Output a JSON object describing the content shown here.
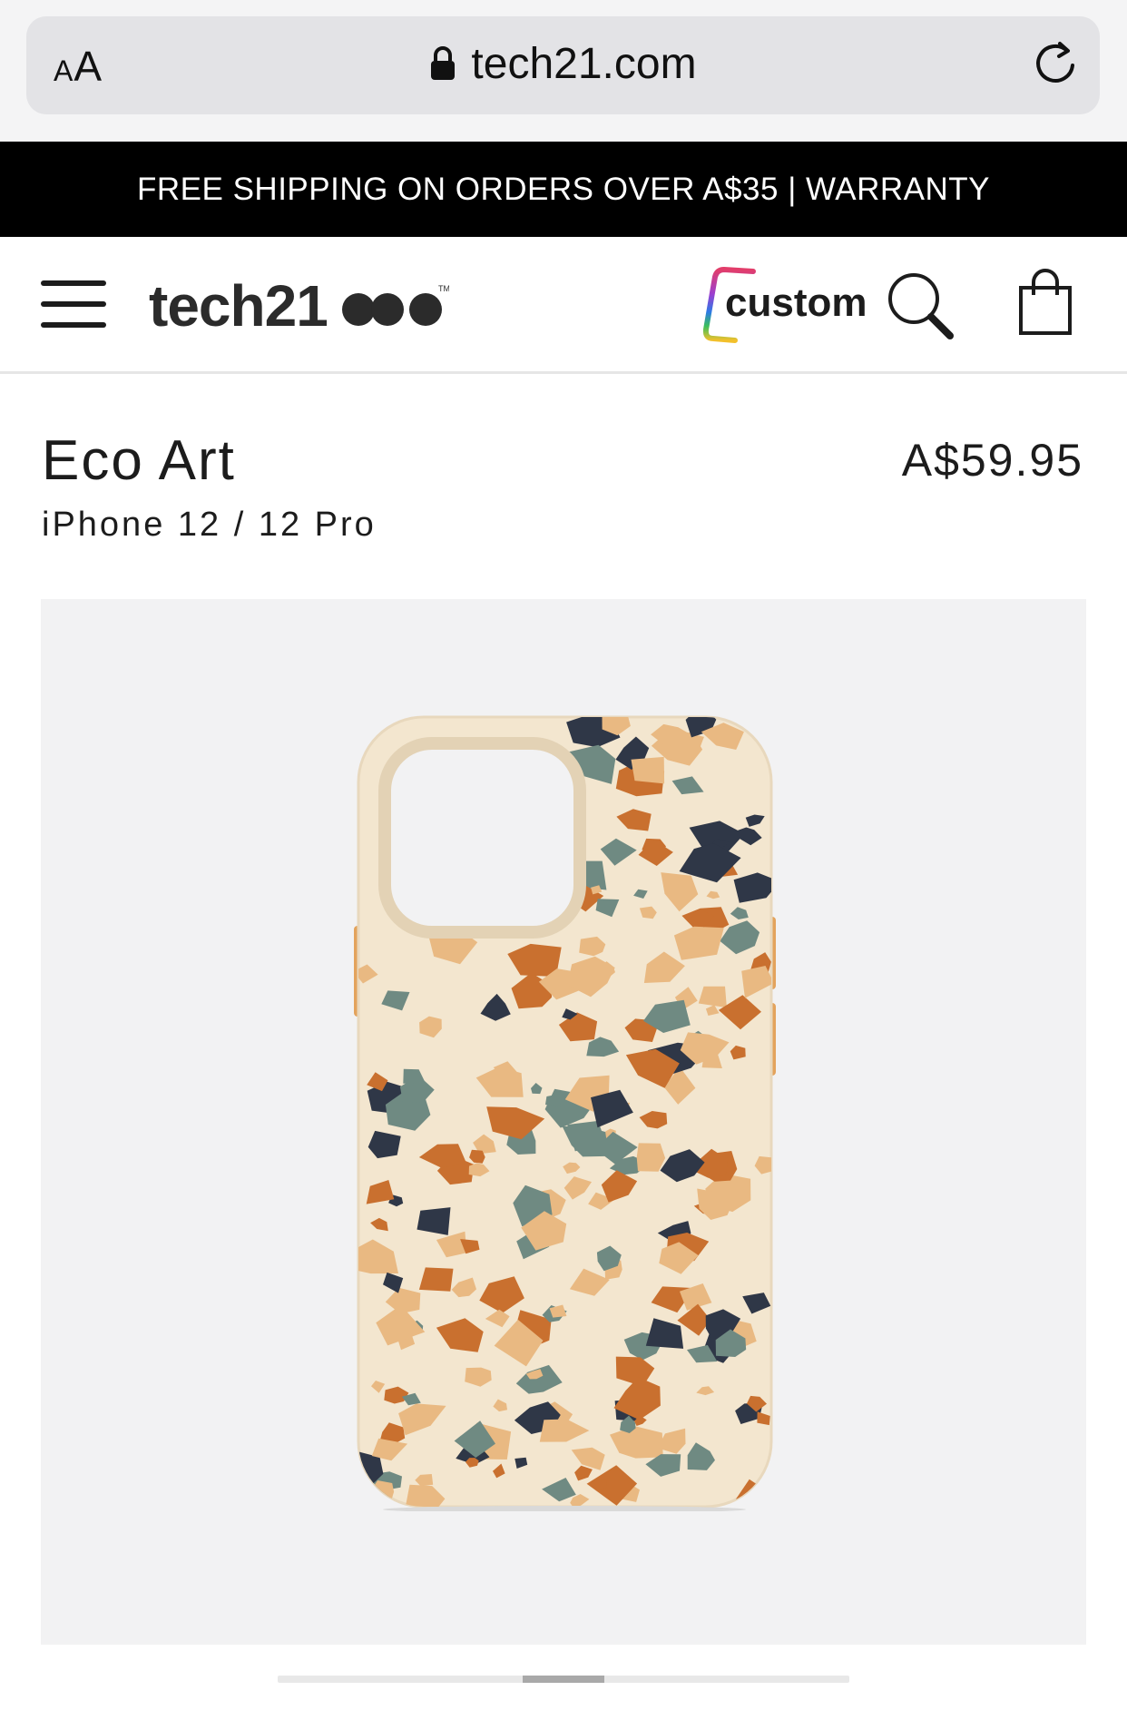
{
  "browser": {
    "text_size_label_small": "A",
    "text_size_label_large": "A",
    "url": "tech21.com",
    "icons": {
      "lock": "lock-icon",
      "reload": "reload-icon"
    }
  },
  "promo": {
    "text": "FREE SHIPPING ON ORDERS OVER A$35 | WARRANTY"
  },
  "header": {
    "logo_text": "tech21",
    "custom_label": "custom",
    "icons": {
      "menu": "hamburger-menu-icon",
      "search": "search-icon",
      "bag": "shopping-bag-icon"
    }
  },
  "product": {
    "title": "Eco Art",
    "subtitle": "iPhone 12 / 12 Pro",
    "price": "A$59.95",
    "image_alt": "terrazzo phone case"
  },
  "gallery": {
    "active_index": 3,
    "slide_count": 7
  },
  "colors": {
    "promo_bg": "#000000",
    "case_base": "#f3e6cf",
    "chip_navy": "#2f3747",
    "chip_teal": "#6f8a82",
    "chip_orange": "#c9702f",
    "chip_sand": "#e9b982"
  }
}
